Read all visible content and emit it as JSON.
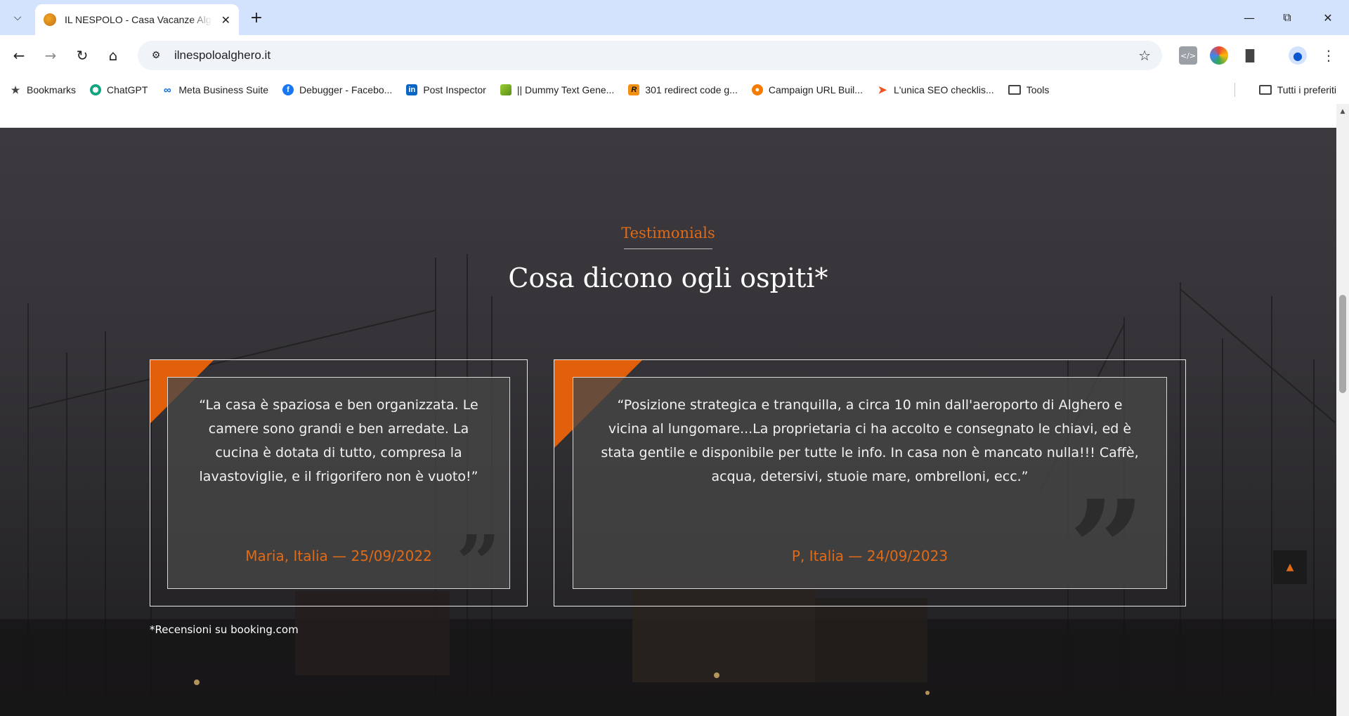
{
  "browser": {
    "tab_title": "IL NESPOLO - Casa Vacanze Alghero",
    "url": "ilnespoloalghero.it",
    "bookmarks": [
      {
        "label": "Bookmarks",
        "icon": "star-icon"
      },
      {
        "label": "ChatGPT",
        "icon": "chatgpt-icon"
      },
      {
        "label": "Meta Business Suite",
        "icon": "meta-icon"
      },
      {
        "label": "Debugger - Facebo...",
        "icon": "facebook-icon"
      },
      {
        "label": "Post Inspector",
        "icon": "linkedin-icon"
      },
      {
        "label": "|| Dummy Text Gene...",
        "icon": "dummy-text-icon"
      },
      {
        "label": "301 redirect code g...",
        "icon": "redirect-icon"
      },
      {
        "label": "Campaign URL Buil...",
        "icon": "campaign-icon"
      },
      {
        "label": "L'unica SEO checklis...",
        "icon": "seo-icon"
      },
      {
        "label": "Tools",
        "icon": "folder-icon"
      }
    ],
    "all_bookmarks": "Tutti i preferiti"
  },
  "section": {
    "tag": "Testimonials",
    "title": "Cosa dicono ogli ospiti*"
  },
  "testimonials": [
    {
      "quote": "“La casa è spaziosa e ben organizzata. Le camere sono grandi e ben arredate. La cucina è dotata di tutto, compresa la lavastoviglie, e il frigorifero non è vuoto!”",
      "author": "Maria, Italia — 25/09/2022"
    },
    {
      "quote": "“Posizione strategica e tranquilla, a circa 10 min dall'aeroporto di Alghero e vicina al lungomare...La proprietaria ci ha accolto e consegnato le chiavi, ed è stata gentile e disponibile per tutte le info. In casa non è mancato nulla!!! Caffè, acqua, detersivi, stuoie mare, ombrelloni, ecc.”",
      "author": "P, Italia — 24/09/2023"
    }
  ],
  "footnote": "*Recensioni su booking.com",
  "colors": {
    "accent": "#e06a16",
    "background_dark": "#2b2a2d"
  }
}
